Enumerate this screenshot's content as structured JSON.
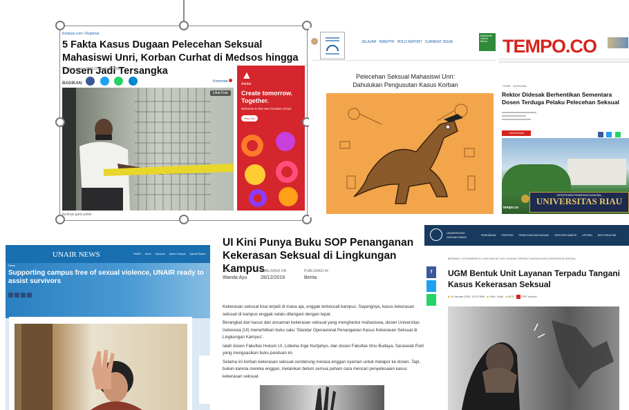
{
  "kompas": {
    "breadcrumb": "Kompas.com / Regional",
    "title": "5 Fakta Kasus Dugaan Pelecehan Seksual Mahasiswi Unri, Korban Curhat di Medsos hingga Dosen Jadi Tersangka",
    "meta": "Kompas.com - 18/11/2021, 11:55 WIB",
    "share_label": "BAGIKAN:",
    "comment_label": "Komentar",
    "photo_button": "Lihat Foto",
    "caption": "Ilustrasi garis polisi",
    "ad_brand": "Adobe",
    "ad_headline": "Create tomorrow. Together.",
    "ad_sub": "Welcome to the new Creative Cloud.",
    "ad_button": "Buy now"
  },
  "unair_mag": {
    "menu": "JELAJAH   INDEPTH   HOLD REPORT   CURRENT ISSUE",
    "title": "Pelecehan Seksual Mahasiswi Unri: Dahulukan Pengusutan Kasus Korban",
    "side_badge": "Mahkamah Liberal Belum"
  },
  "tempo": {
    "logo": "TEMPO.CO",
    "breadcrumb": "HOME   NASIONAL",
    "title": "Rektor Didesak Berhentikan Sementara Dosen Terduga Pelaku Pelecehan Seksual",
    "subscribe": "LANGGANAN",
    "photo_sign_top": "DEPARTEMEN PENDIDIKAN NASIONAL",
    "photo_sign": "UNIVERSITAS RIAU",
    "watermark": "tempo.co"
  },
  "unair": {
    "logo": "UNAIR NEWS",
    "nav": [
      "UNAIR",
      "News",
      "Opinions",
      "Award Campus",
      "Special Report"
    ],
    "category": "News",
    "title": "Supporting campus free of sexual violence, UNAIR ready to assist survivors"
  },
  "ui": {
    "title": "UI Kini Punya Buku SOP Penanganan Kekerasan Seksual di Lingkungan Kampus",
    "author_label": "AUTHOR",
    "author": "Wanda Ayu",
    "published_on_label": "PUBLISHED ON",
    "published_on": "28/12/2019",
    "published_in_label": "PUBLISHED IN",
    "published_in": "Berita",
    "paragraphs": [
      "Kekerasan seksual bisa terjadi di mana aja, enggak terkecuali kampus. Sayangnya, kasus kekerasan seksual di kampus enggak selalu ditangani dengan tepat.",
      "Berangkat dari kasus dan ancaman kekerasan seksual yang menghantui mahasiswa, dosen Universitas Indonesia (UI) menerbitkan buku saku 'Standar Operasional Penanganan Kasus Kekerasan Seksual di Lingkungan Kampus'.",
      "Ialah dosen Fakultas Hukum UI, Lidwina Inge Nurtjahyo, dan dosen Fakultas Ilmu Budaya, Saraswati Putri, yang menguasikan buku panduan ini.",
      "Selama ini korban kekerasan seksual cenderung merasa enggan nyaman untuk melapor ke dosen. Tapi, bukan karena mereka enggan, melainkan belum semua paham cara mencari penyelesaian kasus kekerasan seksual."
    ]
  },
  "ugm": {
    "logo_line1": "UNIVERSITAS",
    "logo_line2": "GADJAH MADA",
    "nav": [
      "PENDIDIKAN",
      "PRESTASI",
      "PENELITIAN DAN INOVASI",
      "SEPUTAR KAMPUS",
      "LIPUTAN",
      "DIES FAKULTAS"
    ],
    "breadcrumb": "BERANDA / LIPUTAN/BERITA / UGM BENTUK UNIT LAYANAN TERPADU TANGANI KASUS KEKERASAN SEKSUAL",
    "title": "UGM Bentuk Unit Layanan Terpadu Tangani Kasus Kekerasan Seksual",
    "date": "15 Januari 2020, 20:23 WIB",
    "author": "Oleh: Gusti",
    "views": "6237",
    "pdf": "PDF Version"
  }
}
